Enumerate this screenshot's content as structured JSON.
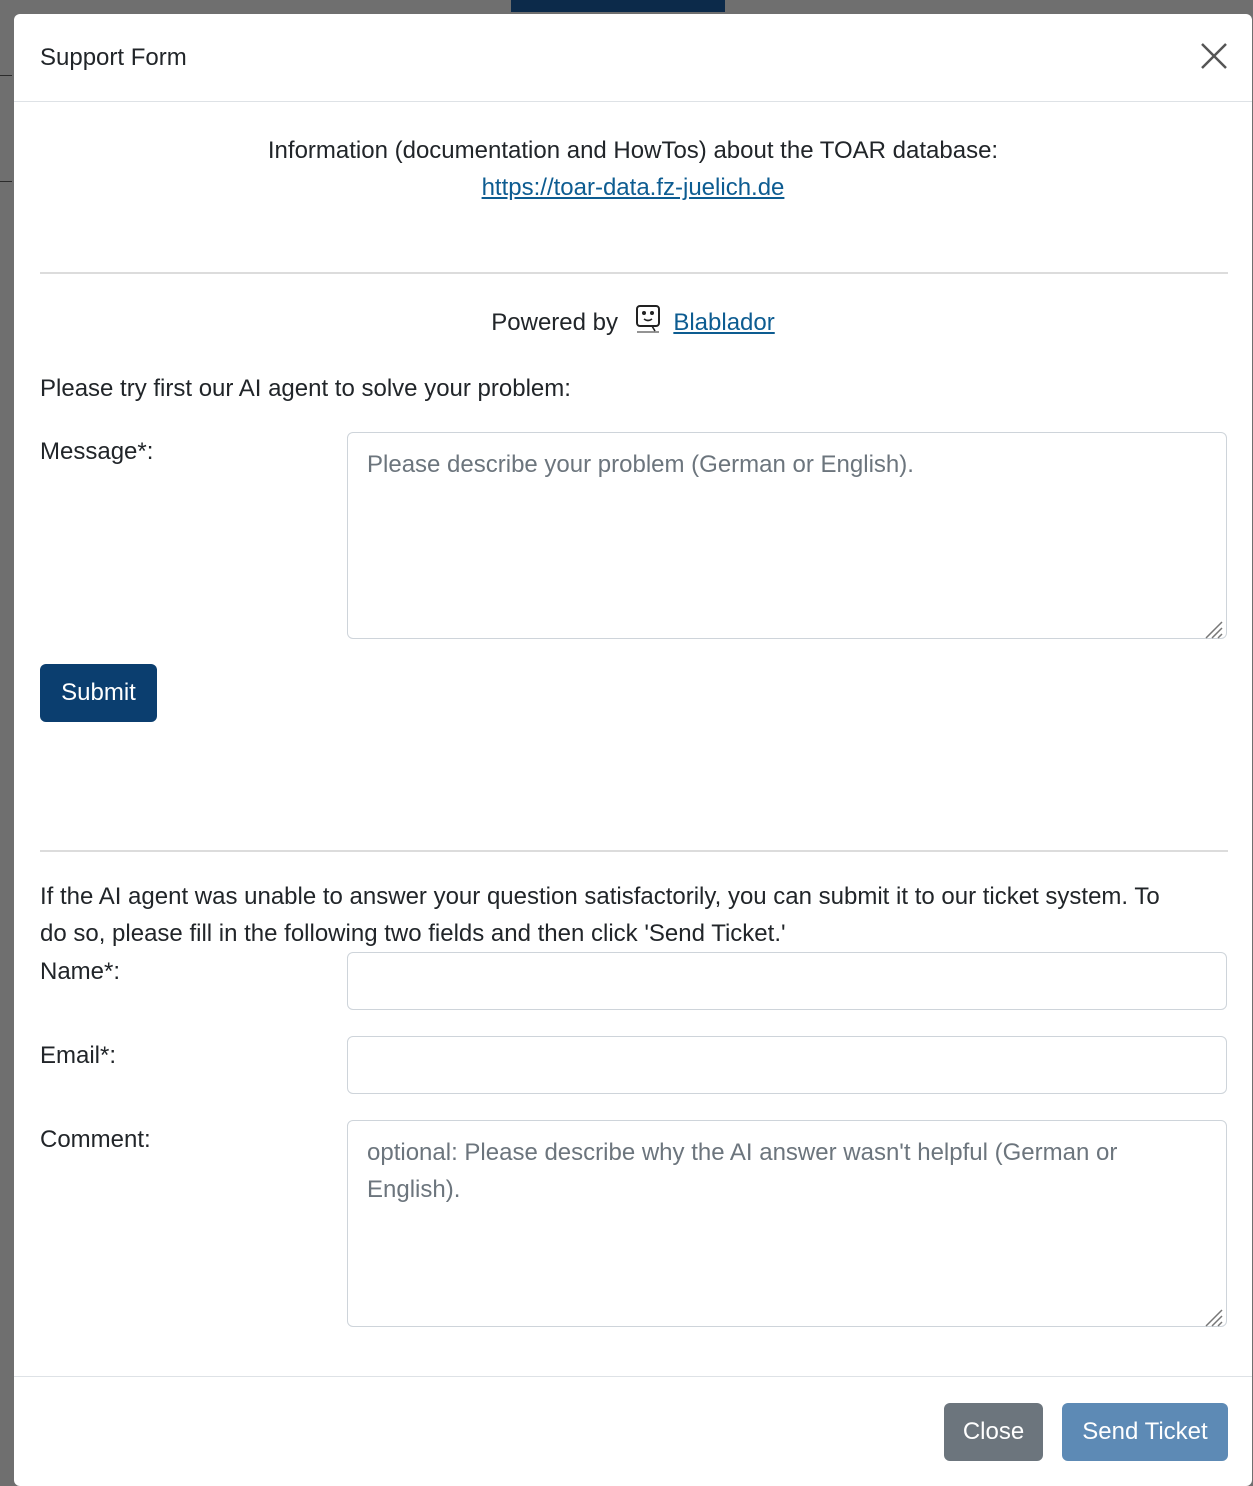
{
  "modal": {
    "title": "Support Form"
  },
  "info": {
    "text": "Information (documentation and HowTos) about the TOAR database:",
    "link": "https://toar-data.fz-juelich.de"
  },
  "powered": {
    "prefix": "Powered by",
    "icon": "robot-icon",
    "link": "Blablador"
  },
  "ai_section": {
    "intro": "Please try first our AI agent to solve your problem:",
    "message_label": "Message*:",
    "message_placeholder": "Please describe your problem (German or English).",
    "submit_label": "Submit"
  },
  "ticket_section": {
    "intro_line1": "If the AI agent was unable to answer your question satisfactorily, you can submit it to our ticket system. To",
    "intro_line2": "do so, please fill in the following two fields and then click 'Send Ticket.'",
    "name_label": "Name*:",
    "name_value": "",
    "email_label": "Email*:",
    "email_value": "",
    "comment_label": "Comment:",
    "comment_placeholder_line1": "optional: Please describe why the AI answer wasn't helpful (German or",
    "comment_placeholder_line2": "English)."
  },
  "footer": {
    "close_label": "Close",
    "send_label": "Send Ticket"
  },
  "colors": {
    "primary": "#0b3e6f",
    "secondary": "#6c757d",
    "send_disabled": "#5d8ab5",
    "link": "#0d5c91"
  }
}
